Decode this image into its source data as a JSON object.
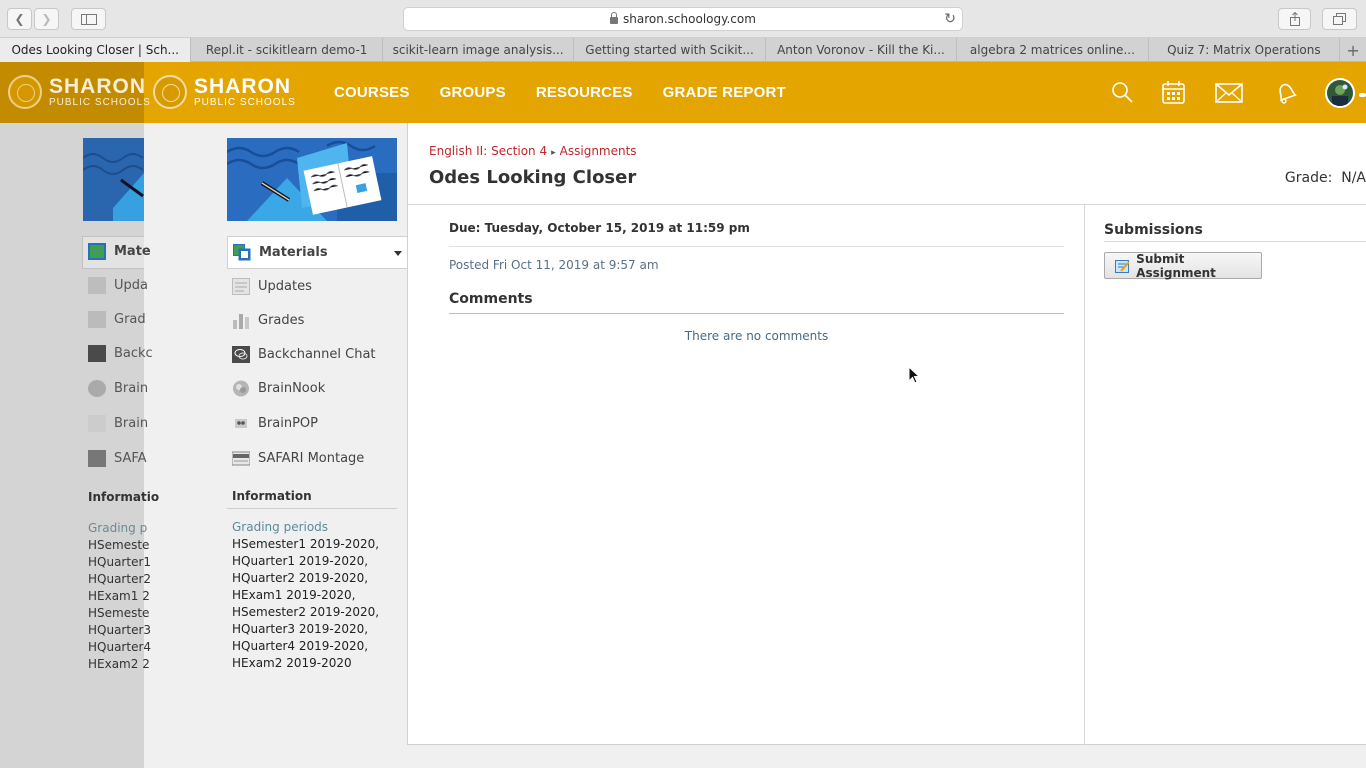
{
  "browser": {
    "url": "sharon.schoology.com",
    "tabs": [
      "Odes Looking Closer | Sch...",
      "Repl.it - scikitlearn demo-1",
      "scikit-learn image analysis...",
      "Getting started with Scikit...",
      "Anton Voronov - Kill the Ki...",
      "algebra 2 matrices online...",
      "Quiz 7: Matrix Operations"
    ],
    "new_tab": "+"
  },
  "header": {
    "logo_name": "SHARON",
    "logo_sub": "PUBLIC SCHOOLS",
    "nav": [
      "COURSES",
      "GROUPS",
      "RESOURCES",
      "GRADE REPORT"
    ],
    "brand_color": "#e5a500"
  },
  "sidebar": {
    "active_item": "Materials",
    "items": [
      "Updates",
      "Grades",
      "Backchannel Chat",
      "BrainNook",
      "BrainPOP",
      "SAFARI Montage"
    ],
    "dim_items": [
      "Upda",
      "Grad",
      "Backc",
      "Brain",
      "Brain",
      "SAFA"
    ],
    "dim_active": "Mate",
    "information_title": "Information",
    "dim_information_title": "Informatio",
    "grading_periods_label": "Grading periods",
    "dim_grading_periods_label": "Grading p",
    "grading_periods": [
      "HSemester1 2019-2020,",
      "HQuarter1 2019-2020,",
      "HQuarter2 2019-2020,",
      "HExam1 2019-2020,",
      "HSemester2 2019-2020,",
      "HQuarter3 2019-2020,",
      "HQuarter4 2019-2020,",
      "HExam2 2019-2020"
    ],
    "dim_grading_periods": [
      "HSemeste",
      "HQuarter1",
      "HQuarter2",
      "HExam1 2",
      "HSemeste",
      "HQuarter3",
      "HQuarter4",
      "HExam2 2"
    ]
  },
  "assignment": {
    "breadcrumb_course": "English II: Section 4",
    "breadcrumb_sep": "▸",
    "breadcrumb_section": "Assignments",
    "title": "Odes Looking Closer",
    "grade_label": "Grade:",
    "grade_value": "N/A",
    "due": "Due: Tuesday, October 15, 2019 at 11:59 pm",
    "posted": "Posted Fri Oct 11, 2019 at 9:57 am",
    "comments_heading": "Comments",
    "no_comments": "There are no comments"
  },
  "submissions": {
    "heading": "Submissions",
    "submit_label": "Submit Assignment"
  }
}
